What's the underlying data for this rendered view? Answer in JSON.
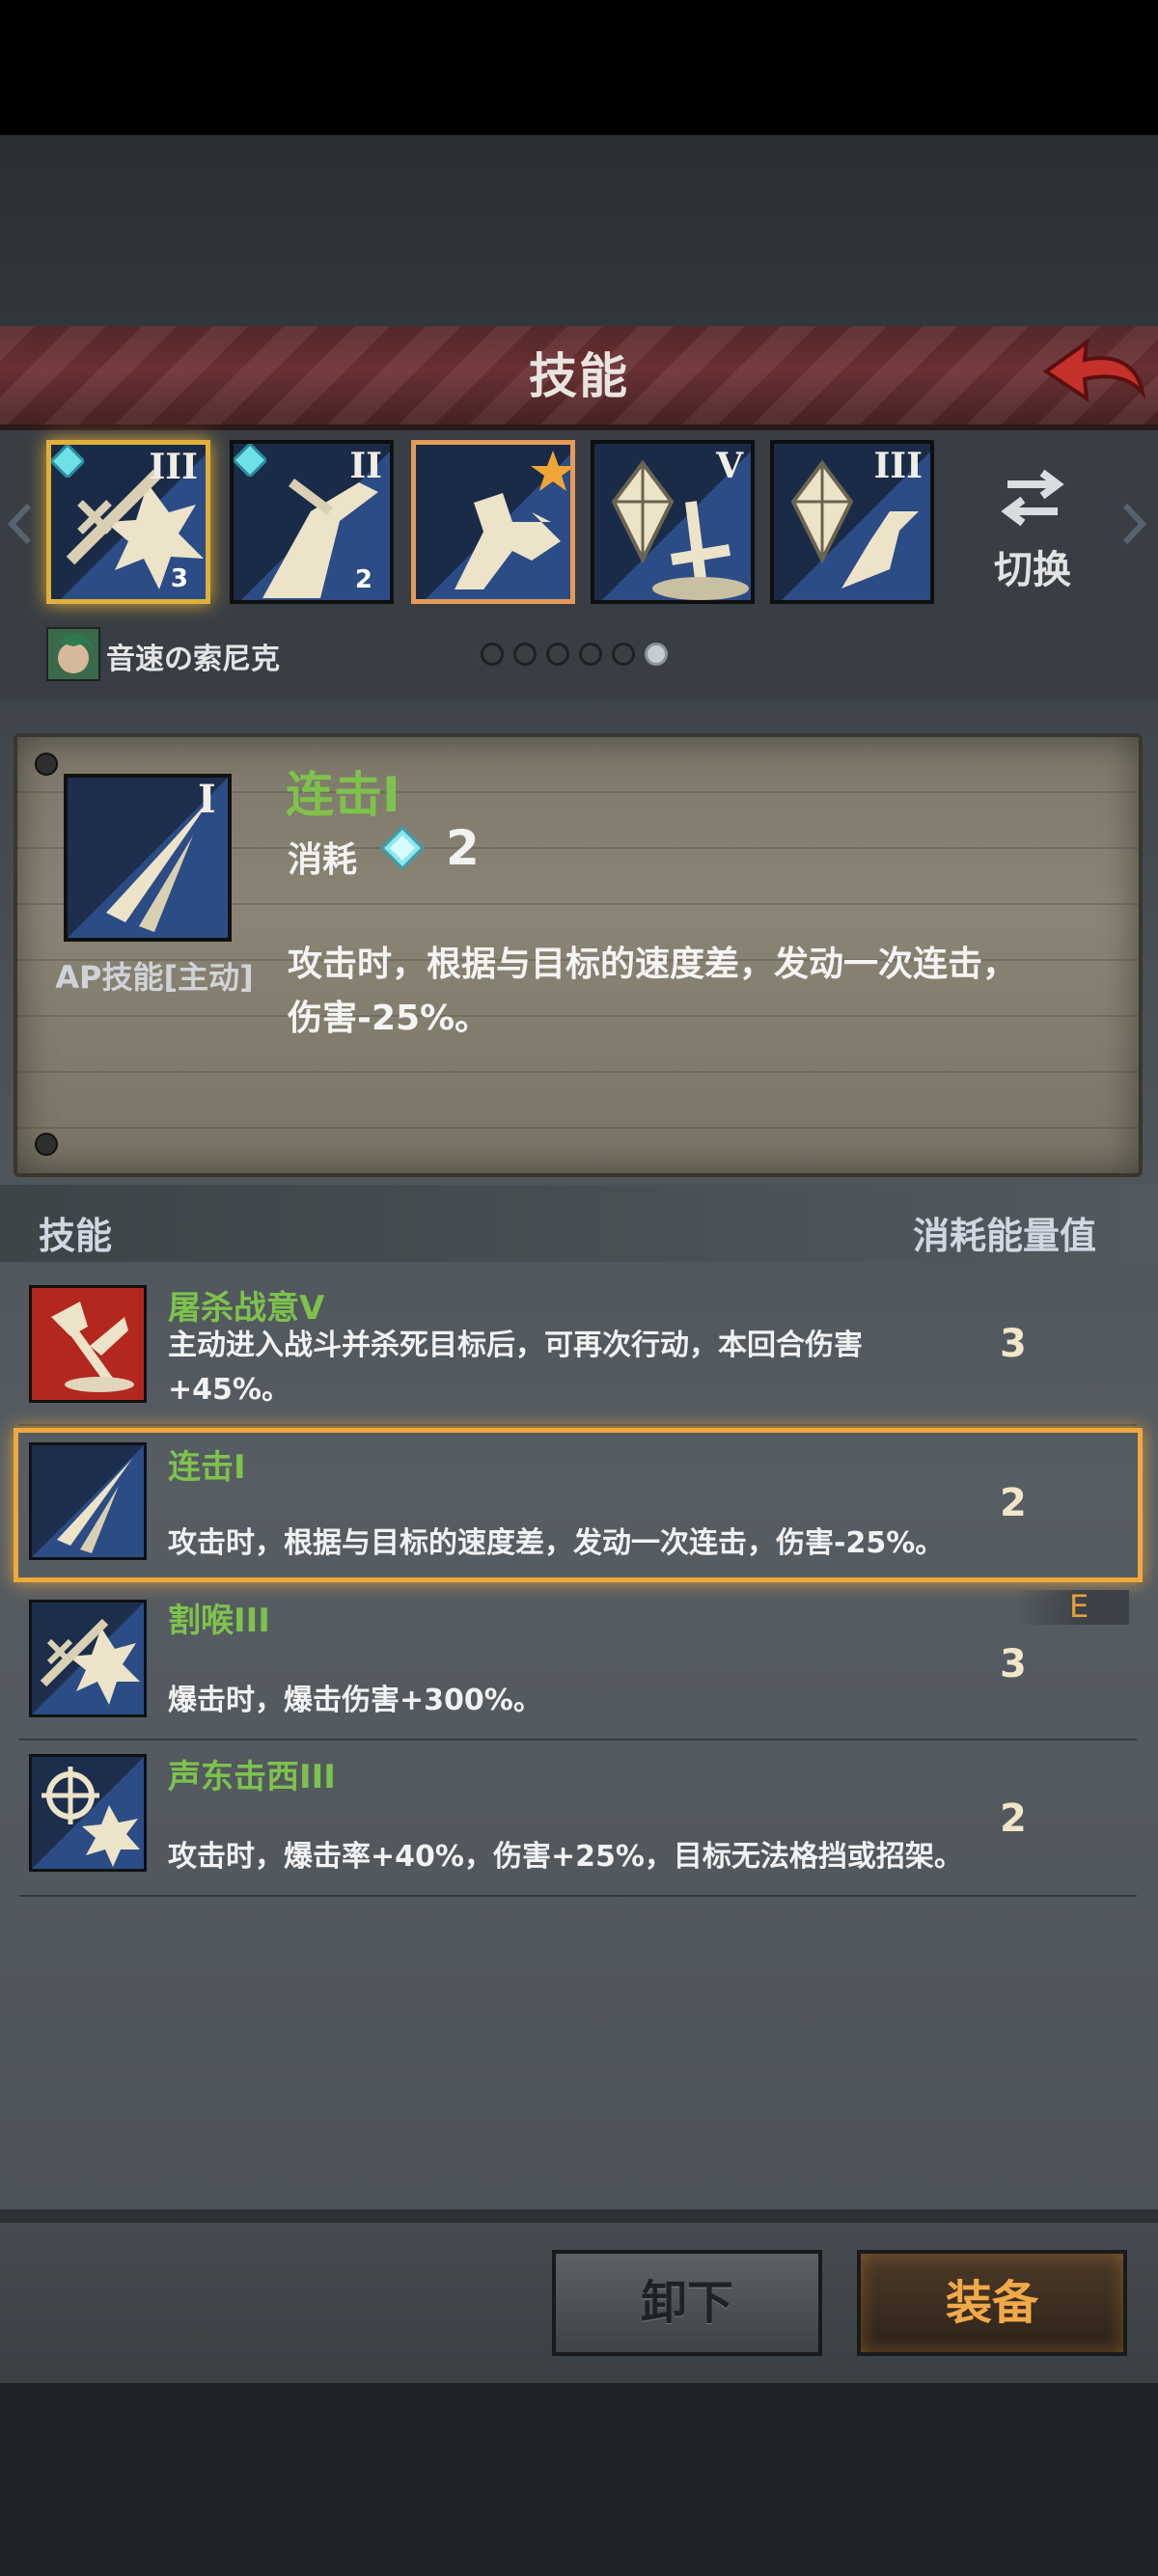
{
  "header": {
    "title": "技能",
    "back_icon": "back-arrow-icon"
  },
  "slots": [
    {
      "roman": "III",
      "gem_count": "3",
      "icon": "slash-burst-icon"
    },
    {
      "roman": "II",
      "gem_count": "2",
      "icon": "blade-rider-icon"
    },
    {
      "roman": "",
      "gem_count": "",
      "icon": "charge-star-icon"
    },
    {
      "roman": "V",
      "gem_count": "",
      "icon": "crystal-sword-icon"
    },
    {
      "roman": "III",
      "gem_count": "",
      "icon": "crystal-rider-icon"
    }
  ],
  "switch": {
    "label": "切换",
    "icon": "swap-arrows-icon"
  },
  "character": {
    "name": "音速の索尼克",
    "page_dots": 6,
    "active_dot": 6
  },
  "detail": {
    "name": "连击I",
    "roman": "I",
    "type": "AP技能[主动]",
    "cost_label": "消耗",
    "cost_value": "2",
    "description_line1": "攻击时，根据与目标的速度差，发动一次连击，",
    "description_line2": "伤害-25%。"
  },
  "list": {
    "header_skill": "技能",
    "header_cost": "消耗能量值",
    "equipped_tag": "E",
    "rows": [
      {
        "name": "屠杀战意V",
        "desc_line1": "主动进入战斗并杀死目标后，可再次行动，本回合伤害",
        "desc_line2": "+45%。",
        "cost": "3",
        "icon": "slaughter-axe-icon"
      },
      {
        "name": "连击I",
        "desc_line1": "",
        "desc_line2": "攻击时，根据与目标的速度差，发动一次连击，伤害-25%。",
        "cost": "2",
        "icon": "combo-blades-icon"
      },
      {
        "name": "割喉III",
        "desc_line1": "",
        "desc_line2": "爆击时，爆击伤害+300%。",
        "cost": "3",
        "icon": "throat-slash-icon"
      },
      {
        "name": "声东击西III",
        "desc_line1": "",
        "desc_line2": "攻击时，爆击率+40%，伤害+25%，目标无法格挡或招架。",
        "cost": "2",
        "icon": "crosshair-burst-icon"
      }
    ]
  },
  "actions": {
    "unequip_label": "卸下",
    "equip_label": "装备"
  },
  "colors": {
    "skill_name_green": "#7ec24c",
    "highlight_orange": "#f0a93a",
    "title_red": "#6e3336"
  }
}
